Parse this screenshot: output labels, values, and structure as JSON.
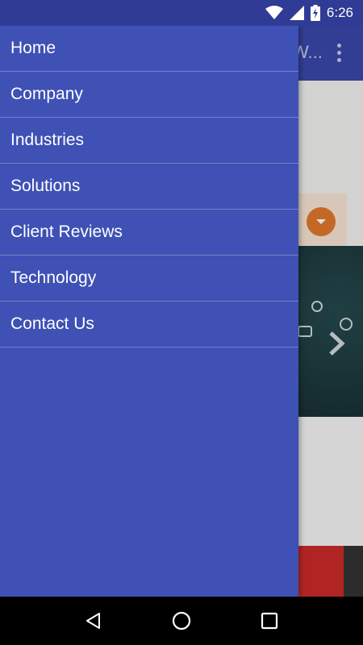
{
  "status_bar": {
    "time": "6:26",
    "icons": [
      "wifi-icon",
      "cell-signal-icon",
      "battery-charging-icon"
    ]
  },
  "background_app": {
    "toolbar_title": "W..."
  },
  "drawer": {
    "items": [
      {
        "label": "Home"
      },
      {
        "label": "Company"
      },
      {
        "label": "Industries"
      },
      {
        "label": "Solutions"
      },
      {
        "label": "Client Reviews"
      },
      {
        "label": "Technology"
      },
      {
        "label": "Contact Us"
      }
    ]
  },
  "nav_bar": {
    "buttons": [
      "back-icon",
      "home-icon",
      "recents-icon"
    ]
  },
  "colors": {
    "drawer": "#3f51b5",
    "status_bar": "#2f3b94",
    "divider": "#7380c8",
    "text": "#ffffff"
  }
}
